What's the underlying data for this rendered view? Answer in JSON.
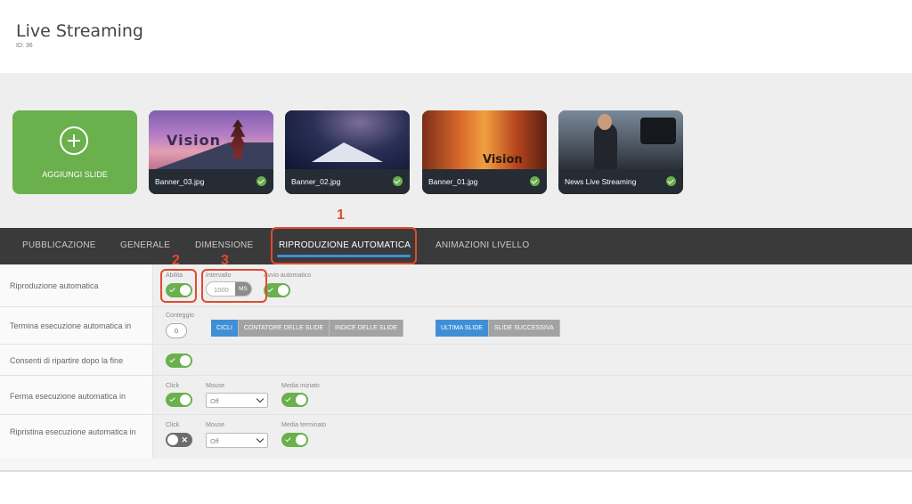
{
  "header": {
    "title": "Live Streaming",
    "id_text": "ID: 36"
  },
  "slides": {
    "add_label": "AGGIUNGI SLIDE",
    "items": [
      {
        "name": "Banner_03.jpg"
      },
      {
        "name": "Banner_02.jpg"
      },
      {
        "name": "Banner_01.jpg"
      },
      {
        "name": "News Live Streaming"
      }
    ],
    "image_text_1": "Vision",
    "image_text_3": "Vision"
  },
  "tabs": [
    {
      "label": "PUBBLICAZIONE",
      "active": false
    },
    {
      "label": "GENERALE",
      "active": false
    },
    {
      "label": "DIMENSIONE",
      "active": false
    },
    {
      "label": "RIPRODUZIONE AUTOMATICA",
      "active": true
    },
    {
      "label": "ANIMAZIONI LIVELLO",
      "active": false
    }
  ],
  "settings": {
    "autoplay": {
      "label": "Riproduzione automatica",
      "enable_label": "Abilita",
      "enable_on": true,
      "interval_label": "Intervallo",
      "interval_value": "1000",
      "interval_unit": "MS",
      "autostart_label": "Avvio automatico",
      "autostart_on": true
    },
    "end_autoplay": {
      "label": "Termina esecuzione automatica in",
      "count_label": "Conteggio",
      "count_value": "0",
      "mode_options": [
        "CICLI",
        "CONTATORE DELLE SLIDE",
        "INDICE DELLE SLIDE"
      ],
      "mode_selected": "CICLI",
      "target_options": [
        "ULTIMA SLIDE",
        "SLIDE SUCCESSIVA"
      ],
      "target_selected": "ULTIMA SLIDE"
    },
    "restart": {
      "label": "Consenti di ripartire dopo la fine",
      "on": true
    },
    "stop_autoplay": {
      "label": "Ferma esecuzione automatica in",
      "click_label": "Click",
      "click_on": true,
      "mouse_label": "Mouse",
      "mouse_value": "Off",
      "media_label": "Media iniziato",
      "media_on": true
    },
    "resume_autoplay": {
      "label": "Ripristina esecuzione automatica in",
      "click_label": "Click",
      "click_on": false,
      "mouse_label": "Mouse",
      "mouse_value": "Off",
      "media_label": "Media terminato",
      "media_on": true
    }
  },
  "callouts": [
    "1",
    "2",
    "3"
  ],
  "colors": {
    "accent_green": "#6ab04c",
    "accent_blue": "#3f8fd6",
    "callout_red": "#e24a31",
    "tab_bar": "#3a3a3a"
  },
  "icons": {
    "add": "plus-circle-icon",
    "ok": "check-circle-icon",
    "select": "chevron-down-icon"
  }
}
